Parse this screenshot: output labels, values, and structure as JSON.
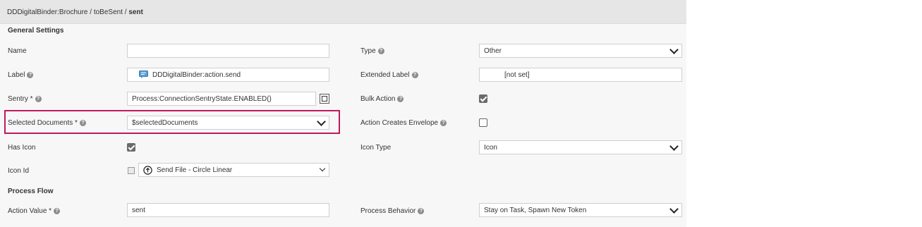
{
  "breadcrumb": {
    "path": "DDDigitalBinder:Brochure / toBeSent / ",
    "current": "sent"
  },
  "sections": {
    "general": "General Settings",
    "process_flow": "Process Flow"
  },
  "fields": {
    "name": {
      "label": "Name",
      "value": ""
    },
    "type": {
      "label": "Type",
      "value": "Other"
    },
    "label": {
      "label": "Label",
      "value": "DDDigitalBinder:action.send"
    },
    "extended_label": {
      "label": "Extended Label",
      "value": "[not set]"
    },
    "sentry": {
      "label": "Sentry *",
      "value": "Process:ConnectionSentryState.ENABLED()"
    },
    "bulk_action": {
      "label": "Bulk Action",
      "checked": true
    },
    "selected_documents": {
      "label": "Selected Documents *",
      "value": "$selectedDocuments"
    },
    "action_creates_envelope": {
      "label": "Action Creates Envelope",
      "checked": false
    },
    "has_icon": {
      "label": "Has Icon",
      "checked": true
    },
    "icon_type": {
      "label": "Icon Type",
      "value": "Icon"
    },
    "icon_id": {
      "label": "Icon Id",
      "value": "Send File - Circle Linear"
    },
    "action_value": {
      "label": "Action Value *",
      "value": "sent"
    },
    "process_behavior": {
      "label": "Process Behavior",
      "value": "Stay on Task, Spawn New Token"
    }
  },
  "help_glyph": "?",
  "colors": {
    "highlight": "#c2185b",
    "checkbox": "#6b6b6b",
    "label_icon_bg": "#5a9bd5"
  }
}
